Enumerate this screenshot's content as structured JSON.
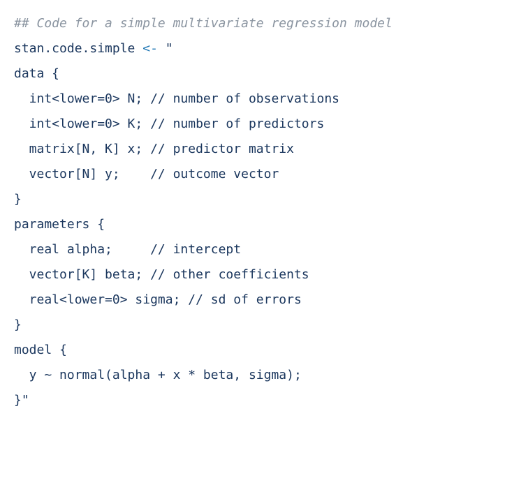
{
  "code": {
    "comment_header": "## Code for a simple multivariate regression model",
    "var_name": "stan.code.simple",
    "assign_op": "<-",
    "open_quote": "\"",
    "lines": {
      "l1": "data {",
      "l2": "  int<lower=0> N; // number of observations",
      "l3": "  int<lower=0> K; // number of predictors",
      "l4": "  matrix[N, K] x; // predictor matrix",
      "l5": "  vector[N] y;    // outcome vector",
      "l6": "}",
      "l7": "parameters {",
      "l8": "  real alpha;     // intercept",
      "l9": "  vector[K] beta; // other coefficients",
      "l10": "  real<lower=0> sigma; // sd of errors",
      "l11": "}",
      "l12": "model {",
      "l13": "  y ~ normal(alpha + x * beta, sigma);",
      "l14": "}\""
    }
  }
}
